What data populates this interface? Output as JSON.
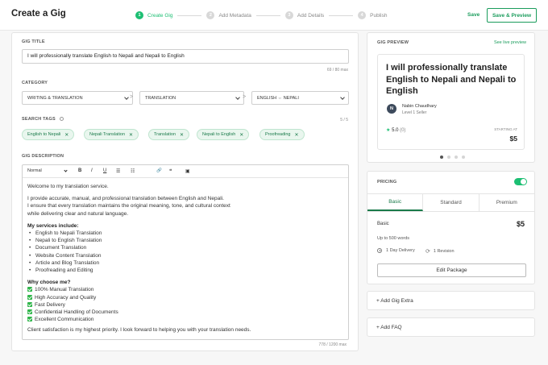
{
  "header": {
    "title": "Create a Gig",
    "steps": [
      {
        "num": "1",
        "label": "Create Gig",
        "active": true
      },
      {
        "num": "2",
        "label": "Add Metadata",
        "active": false
      },
      {
        "num": "3",
        "label": "Add Details",
        "active": false
      },
      {
        "num": "4",
        "label": "Publish",
        "active": false
      }
    ],
    "save_label": "Save",
    "save_preview_label": "Save & Preview"
  },
  "gig_title": {
    "label": "GIG TITLE",
    "value": "I will professionally translate English to Nepali and Nepali to English",
    "count": "69 / 80 max"
  },
  "category": {
    "label": "CATEGORY",
    "main": "WRITING & TRANSLATION",
    "sub": "TRANSLATION",
    "service": "ENGLISH ⇔ NEPALI",
    "separator": ">"
  },
  "tags": {
    "label": "SEARCH TAGS",
    "count": "5 / 5",
    "items": [
      "English to Nepali",
      "Nepali Translation",
      "Translation",
      "Nepali to English",
      "Proofreading"
    ],
    "remove_glyph": "✕"
  },
  "description": {
    "label": "GIG DESCRIPTION",
    "toolbar": {
      "format": "Normal",
      "bold": "B",
      "italic": "I",
      "underline": "U",
      "bullet_list": "☰",
      "numbered_list": "☷",
      "link": "🔗",
      "quote": "❝",
      "image": "▣"
    },
    "welcome": "Welcome to my translation service.",
    "intro_1": "I provide accurate, manual, and professional translation between English and Nepali.",
    "intro_2": "I ensure that every translation maintains the original meaning, tone, and cultural context",
    "intro_3": "while delivering clear and natural language.",
    "services_heading": "My services include:",
    "services": [
      "English to Nepali Translation",
      "Nepali to English Translation",
      "Document Translation",
      "Website Content Translation",
      "Article and Blog Translation",
      "Proofreading and Editing"
    ],
    "why_heading": "Why choose me?",
    "reasons": [
      "100% Manual Translation",
      "High Accuracy and Quality",
      "Fast Delivery",
      "Confidential Handling of Documents",
      "Excellent Communication"
    ],
    "closing": "Client satisfaction is my highest priority. I look forward to helping you with your translation needs.",
    "count": "778 / 1200 max"
  },
  "preview": {
    "label": "GIG PREVIEW",
    "link": "See live preview",
    "title": "I will professionally translate English to Nepali and Nepali to English",
    "avatar_initial": "N",
    "seller_name": "Nabin Chaudhary",
    "seller_level": "Level 1 Seller",
    "star": "★",
    "rating": "5.0",
    "reviews": "(0)",
    "starting_label": "STARTING AT",
    "price": "$5"
  },
  "pricing": {
    "label": "PRICING",
    "enabled": true,
    "tabs": [
      "Basic",
      "Standard",
      "Premium"
    ],
    "package_name": "Basic",
    "package_price": "$5",
    "package_desc": "Up to 500 words",
    "delivery": "1 Day Delivery",
    "revision": "1 Revision",
    "edit_label": "Edit Package"
  },
  "extras": {
    "add_extra": "+ Add Gig Extra",
    "add_faq": "+ Add FAQ"
  },
  "colors": {
    "accent": "#1dbf73",
    "accent_dark": "#1a7a4a"
  }
}
